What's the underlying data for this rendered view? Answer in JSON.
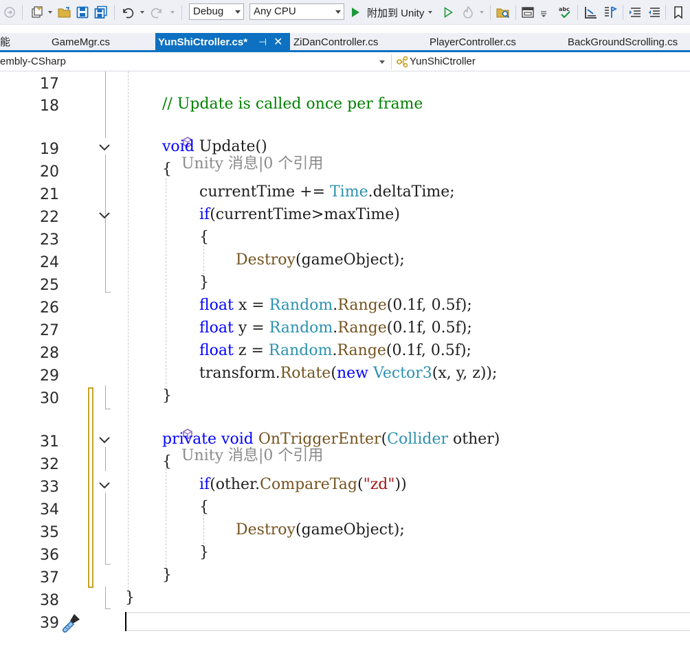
{
  "toolbar": {
    "config": "Debug",
    "platform": "Any CPU",
    "run_label": "附加到 Unity"
  },
  "tabs": {
    "cut_label": "能",
    "items": [
      {
        "label": "GameMgr.cs"
      },
      {
        "label": "YunShiCtroller.cs*"
      },
      {
        "label": "ZiDanController.cs"
      },
      {
        "label": "PlayerController.cs"
      },
      {
        "label": "BackGroundScrolling.cs"
      }
    ],
    "pin_glyph": "⊣",
    "close_glyph": "✕"
  },
  "navbar": {
    "project": "embly-CSharp",
    "class": "YunShiCtroller"
  },
  "editor": {
    "lens_text": "Unity 消息|0 个引用",
    "lines": {
      "n17": "17",
      "n18": "18",
      "n19": "19",
      "n20": "20",
      "n21": "21",
      "n22": "22",
      "n23": "23",
      "n24": "24",
      "n25": "25",
      "n26": "26",
      "n27": "27",
      "n28": "28",
      "n29": "29",
      "n30": "30",
      "n31": "31",
      "n32": "32",
      "n33": "33",
      "n34": "34",
      "n35": "35",
      "n36": "36",
      "n37": "37",
      "n38": "38",
      "n39": "39"
    },
    "code": {
      "l18_comment": "// Update is called once per frame",
      "l19_void": "void",
      "l19_name": "Update",
      "l19_parens": "()",
      "l20": "{",
      "l21_a": "currentTime += ",
      "l21_type": "Time",
      "l21_b": ".deltaTime;",
      "l22_if": "if",
      "l22_rest": "(currentTime>maxTime)",
      "l23": "{",
      "l24_method": "Destroy",
      "l24_rest": "(gameObject);",
      "l25": "}",
      "l26_kw": "float",
      "l26_a": " x = ",
      "l26_type": "Random",
      "l26_dot": ".",
      "l26_method": "Range",
      "l26_rest": "(0.1f, 0.5f);",
      "l27_kw": "float",
      "l27_a": " y = ",
      "l27_type": "Random",
      "l27_dot": ".",
      "l27_method": "Range",
      "l27_rest": "(0.1f, 0.5f);",
      "l28_kw": "float",
      "l28_a": " z = ",
      "l28_type": "Random",
      "l28_dot": ".",
      "l28_method": "Range",
      "l28_rest": "(0.1f, 0.5f);",
      "l29_a": "transform.",
      "l29_method": "Rotate",
      "l29_paren": "(",
      "l29_new": "new",
      "l29_sp": " ",
      "l29_type": "Vector3",
      "l29_rest": "(x, y, z));",
      "l30": "}",
      "l31_private": "private",
      "l31_void": " void ",
      "l31_name": "OnTriggerEnter",
      "l31_paren": "(",
      "l31_type": "Collider",
      "l31_rest": " other)",
      "l32": "{",
      "l33_if": "if",
      "l33_a": "(other.",
      "l33_method": "CompareTag",
      "l33_paren": "(",
      "l33_str": "\"zd\"",
      "l33_rest": "))",
      "l34": "{",
      "l35_method": "Destroy",
      "l35_rest": "(gameObject);",
      "l36": "}",
      "l37": "}",
      "l38": "}"
    }
  },
  "colors": {
    "keyword": "#0000ff",
    "type": "#2b91af",
    "method": "#74531f",
    "comment": "#008000",
    "string": "#a31515",
    "active_tab": "#0e70c0"
  }
}
